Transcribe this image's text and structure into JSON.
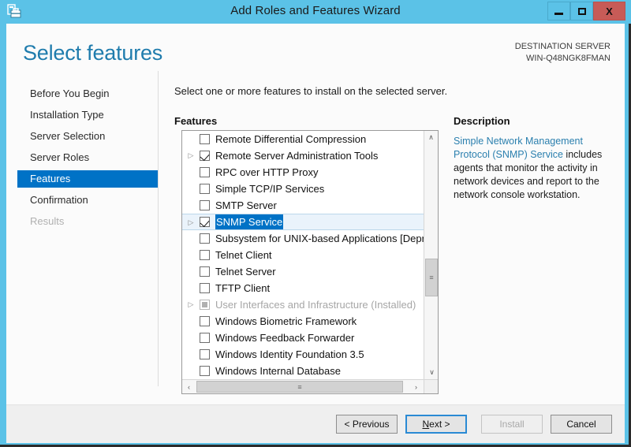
{
  "window": {
    "title": "Add Roles and Features Wizard",
    "icon": "server-manager-icon",
    "controls": {
      "minimize": "–",
      "maximize": "□",
      "close": "X"
    }
  },
  "header": {
    "page_title": "Select features",
    "destination_label": "DESTINATION SERVER",
    "destination_server": "WIN-Q48NGK8FMAN"
  },
  "sidebar": {
    "items": [
      {
        "label": "Before You Begin",
        "state": "normal"
      },
      {
        "label": "Installation Type",
        "state": "normal"
      },
      {
        "label": "Server Selection",
        "state": "normal"
      },
      {
        "label": "Server Roles",
        "state": "normal"
      },
      {
        "label": "Features",
        "state": "active"
      },
      {
        "label": "Confirmation",
        "state": "normal"
      },
      {
        "label": "Results",
        "state": "disabled"
      }
    ],
    "active_color": "#0072c6"
  },
  "content": {
    "instruction": "Select one or more features to install on the selected server.",
    "features_label": "Features",
    "description_label": "Description",
    "description_link": "Simple Network Management Protocol (SNMP) Service",
    "description_rest": " includes agents that monitor the activity in network devices and report to the network console workstation.",
    "features": [
      {
        "label": "Remote Differential Compression",
        "checked": false,
        "expander": false,
        "selected": false,
        "installed": false
      },
      {
        "label": "Remote Server Administration Tools",
        "checked": true,
        "expander": true,
        "selected": false,
        "installed": false
      },
      {
        "label": "RPC over HTTP Proxy",
        "checked": false,
        "expander": false,
        "selected": false,
        "installed": false
      },
      {
        "label": "Simple TCP/IP Services",
        "checked": false,
        "expander": false,
        "selected": false,
        "installed": false
      },
      {
        "label": "SMTP Server",
        "checked": false,
        "expander": false,
        "selected": false,
        "installed": false
      },
      {
        "label": "SNMP Service",
        "checked": true,
        "expander": true,
        "selected": true,
        "installed": false
      },
      {
        "label": "Subsystem for UNIX-based Applications [Deprecat",
        "checked": false,
        "expander": false,
        "selected": false,
        "installed": false
      },
      {
        "label": "Telnet Client",
        "checked": false,
        "expander": false,
        "selected": false,
        "installed": false
      },
      {
        "label": "Telnet Server",
        "checked": false,
        "expander": false,
        "selected": false,
        "installed": false
      },
      {
        "label": "TFTP Client",
        "checked": false,
        "expander": false,
        "selected": false,
        "installed": false
      },
      {
        "label": "User Interfaces and Infrastructure (Installed)",
        "checked": false,
        "expander": true,
        "selected": false,
        "installed": true
      },
      {
        "label": "Windows Biometric Framework",
        "checked": false,
        "expander": false,
        "selected": false,
        "installed": false
      },
      {
        "label": "Windows Feedback Forwarder",
        "checked": false,
        "expander": false,
        "selected": false,
        "installed": false
      },
      {
        "label": "Windows Identity Foundation 3.5",
        "checked": false,
        "expander": false,
        "selected": false,
        "installed": false
      },
      {
        "label": "Windows Internal Database",
        "checked": false,
        "expander": false,
        "selected": false,
        "installed": false
      }
    ],
    "scroll": {
      "up_arrow": "∧",
      "down_arrow": "∨",
      "left_arrow": "‹",
      "right_arrow": "›",
      "grip": "≡"
    }
  },
  "footer": {
    "previous": "< Previous",
    "next_pre": "N",
    "next_post": "ext >",
    "install": "Install",
    "cancel": "Cancel"
  }
}
